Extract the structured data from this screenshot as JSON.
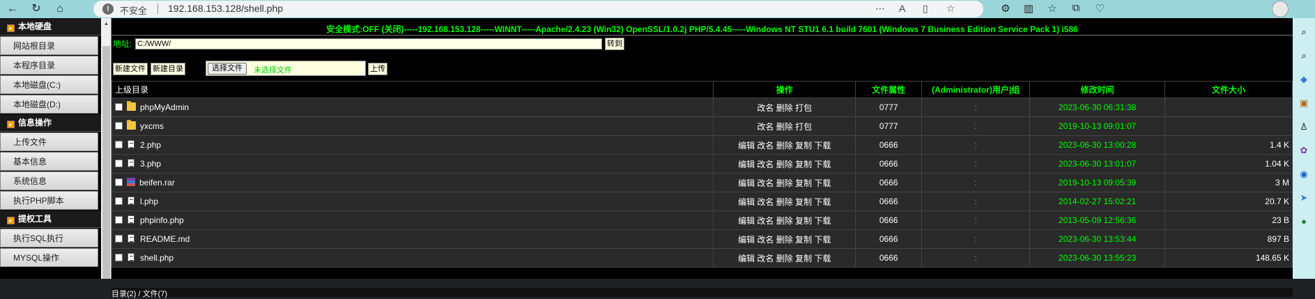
{
  "browser": {
    "security_label": "不安全",
    "url": "192.168.153.128/shell.php",
    "colors": {
      "chrome": "#9ad6d9"
    }
  },
  "server_info": "安全模式:OFF (关闭)-----192.168.153.128-----WINNT-----Apache/2.4.23 (Win32) OpenSSL/1.0.2j PHP/5.4.45-----Windows NT STU1 6.1 build 7601 (Windows 7 Business Edition Service Pack 1) i586",
  "sidebar": {
    "sections": [
      {
        "title": "本地硬盘",
        "items": [
          "网站根目录",
          "本程序目录",
          "本地磁盘(C:)",
          "本地磁盘(D:)"
        ]
      },
      {
        "title": "信息操作",
        "items": [
          "上传文件",
          "基本信息",
          "系统信息",
          "执行PHP脚本"
        ]
      },
      {
        "title": "提权工具",
        "items": [
          "执行SQL执行",
          "MYSQL操作"
        ]
      }
    ]
  },
  "toolbar": {
    "address_label": "地址:",
    "address_value": "C:/WWW/",
    "goto_label": "转到",
    "new_file_label": "新建文件",
    "new_dir_label": "新建目录",
    "choose_file_label": "选择文件",
    "no_file_label": "未选择文件",
    "upload_label": "上传"
  },
  "table": {
    "headers": [
      "上级目录",
      "操作",
      "文件属性",
      "(Administrator)用户|组",
      "修改时间",
      "文件大小"
    ],
    "rows": [
      {
        "type": "folder",
        "name": "phpMyAdmin",
        "ops": "改名 删除 打包",
        "perm": "0777",
        "owner": ":",
        "time": "2023-06-30 06:31:38",
        "size": ""
      },
      {
        "type": "folder",
        "name": "yxcms",
        "ops": "改名 删除 打包",
        "perm": "0777",
        "owner": ":",
        "time": "2019-10-13 09:01:07",
        "size": ""
      },
      {
        "type": "file",
        "name": "2.php",
        "ops": "编辑 改名 删除 复制 下载",
        "perm": "0666",
        "owner": ":",
        "time": "2023-06-30 13:00:28",
        "size": "1.4 K"
      },
      {
        "type": "file",
        "name": "3.php",
        "ops": "编辑 改名 删除 复制 下载",
        "perm": "0666",
        "owner": ":",
        "time": "2023-06-30 13:01:07",
        "size": "1.04 K"
      },
      {
        "type": "rar",
        "name": "beifen.rar",
        "ops": "编辑 改名 删除 复制 下载",
        "perm": "0666",
        "owner": ":",
        "time": "2019-10-13 09:05:39",
        "size": "3 M"
      },
      {
        "type": "file",
        "name": "l.php",
        "ops": "编辑 改名 删除 复制 下载",
        "perm": "0666",
        "owner": ":",
        "time": "2014-02-27 15:02:21",
        "size": "20.7 K"
      },
      {
        "type": "file",
        "name": "phpinfo.php",
        "ops": "编辑 改名 删除 复制 下载",
        "perm": "0666",
        "owner": ":",
        "time": "2013-05-09 12:56:36",
        "size": "23 B"
      },
      {
        "type": "file",
        "name": "README.md",
        "ops": "编辑 改名 删除 复制 下载",
        "perm": "0666",
        "owner": ":",
        "time": "2023-06-30 13:53:44",
        "size": "897 B"
      },
      {
        "type": "file",
        "name": "shell.php",
        "ops": "编辑 改名 删除 复制 下载",
        "perm": "0666",
        "owner": ":",
        "time": "2023-06-30 13:55:23",
        "size": "148.65 K"
      }
    ]
  },
  "footer": {
    "summary": "目录(2) / 文件(7)"
  }
}
